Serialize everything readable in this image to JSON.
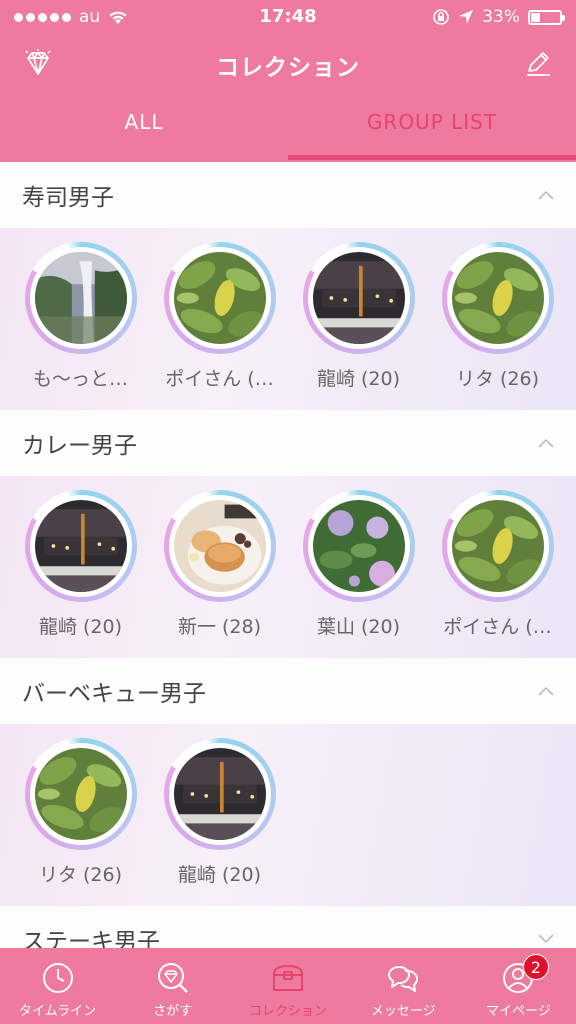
{
  "status": {
    "carrier": "au",
    "time": "17:48",
    "battery": "33%",
    "battery_level": 0.33
  },
  "nav": {
    "title": "コレクション",
    "left_icon": "diamond-icon",
    "right_icon": "edit-icon"
  },
  "tabs": [
    {
      "label": "ALL",
      "active": false
    },
    {
      "label": "GROUP LIST",
      "active": true
    }
  ],
  "groups": [
    {
      "name": "寿司男子",
      "expanded": true,
      "members": [
        {
          "name": "も〜っと…",
          "photo": "waterfall"
        },
        {
          "name": "ポイさん (…",
          "photo": "leaves"
        },
        {
          "name": "龍崎 (20)",
          "photo": "night"
        },
        {
          "name": "リタ (26)",
          "photo": "leaves"
        }
      ]
    },
    {
      "name": "カレー男子",
      "expanded": true,
      "members": [
        {
          "name": "龍崎 (20)",
          "photo": "night"
        },
        {
          "name": "新一 (28)",
          "photo": "pancake"
        },
        {
          "name": "葉山 (20)",
          "photo": "hydrangea"
        },
        {
          "name": "ポイさん (…",
          "photo": "leaves"
        }
      ]
    },
    {
      "name": "バーベキュー男子",
      "expanded": true,
      "members": [
        {
          "name": "リタ (26)",
          "photo": "leaves"
        },
        {
          "name": "龍崎 (20)",
          "photo": "night"
        }
      ]
    },
    {
      "name": "ステーキ男子",
      "expanded": false,
      "members": []
    }
  ],
  "tabbar": [
    {
      "label": "タイムライン",
      "icon": "clock-icon"
    },
    {
      "label": "さがす",
      "icon": "diamond-search-icon"
    },
    {
      "label": "コレクション",
      "icon": "chest-icon",
      "active": true
    },
    {
      "label": "メッセージ",
      "icon": "chat-icon"
    },
    {
      "label": "マイページ",
      "icon": "user-icon",
      "badge": "2"
    }
  ],
  "colors": {
    "header": "#ee7a9d",
    "accent": "#e8436f",
    "badge": "#e0102b"
  }
}
